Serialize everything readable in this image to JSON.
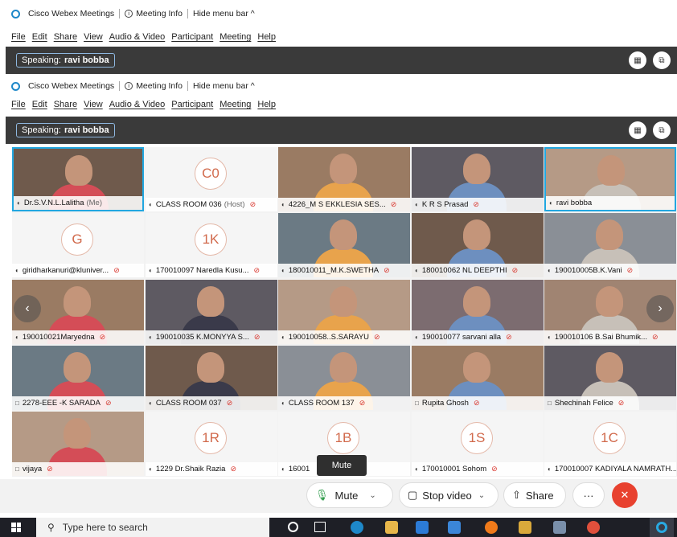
{
  "app": {
    "name": "Cisco Webex Meetings",
    "meeting_info": "Meeting Info",
    "hide_menu_bar": "Hide menu bar ^"
  },
  "menu": [
    "File",
    "Edit",
    "Share",
    "View",
    "Audio & Video",
    "Participant",
    "Meeting",
    "Help"
  ],
  "speaking": {
    "label": "Speaking:",
    "name": "ravi bobba"
  },
  "tiles": [
    {
      "name": "Dr.S.V.N.L.Lalitha",
      "suffix": "(Me)",
      "kind": "video",
      "muted": false
    },
    {
      "name": "CLASS ROOM 036",
      "suffix": "(Host)",
      "kind": "avatar",
      "initials": "C0",
      "muted": true
    },
    {
      "name": "4226_M S EKKLESIA SES...",
      "kind": "video",
      "muted": true
    },
    {
      "name": "K R S Prasad",
      "kind": "video",
      "muted": true
    },
    {
      "name": "ravi bobba",
      "kind": "video",
      "muted": false
    },
    {
      "name": "giridharkanuri@kluniver...",
      "kind": "avatar",
      "initials": "G",
      "muted": true
    },
    {
      "name": "170010097 Naredla Kusu...",
      "kind": "avatar",
      "initials": "1K",
      "muted": true
    },
    {
      "name": "180010011_M.K.SWETHA",
      "kind": "video",
      "muted": true
    },
    {
      "name": "180010062 NL DEEPTHI",
      "kind": "video",
      "muted": true
    },
    {
      "name": "190010005B.K.Vani",
      "kind": "video",
      "muted": true
    },
    {
      "name": "190010021Maryedna",
      "kind": "video",
      "muted": true
    },
    {
      "name": "190010035 K.MONYYA S...",
      "kind": "video",
      "muted": true
    },
    {
      "name": "190010058..S.SARAYU",
      "kind": "video",
      "muted": true
    },
    {
      "name": "190010077 sarvani alla",
      "kind": "video",
      "muted": true
    },
    {
      "name": "190010106 B.Sai Bhumik...",
      "kind": "video",
      "muted": true
    },
    {
      "name": "2278-EEE -K SARADA",
      "kind": "video",
      "muted": true
    },
    {
      "name": "CLASS ROOM 037",
      "kind": "video",
      "muted": true
    },
    {
      "name": "CLASS ROOM 137",
      "kind": "video",
      "muted": true
    },
    {
      "name": "Rupita Ghosh",
      "kind": "video",
      "muted": true
    },
    {
      "name": "Shechinah Felice",
      "kind": "video",
      "muted": true
    },
    {
      "name": "vijaya",
      "kind": "video",
      "muted": true
    },
    {
      "name": "1229 Dr.Shaik Razia",
      "kind": "avatar",
      "initials": "1R",
      "muted": true
    },
    {
      "name": "16001",
      "kind": "avatar",
      "initials": "1B",
      "muted": false
    },
    {
      "name": "170010001 Sohom",
      "kind": "avatar",
      "initials": "1S",
      "muted": true
    },
    {
      "name": "170010007 KADIYALA NAMRATH...",
      "kind": "avatar",
      "initials": "1C",
      "muted": false
    }
  ],
  "tooltip": "Mute",
  "controls": {
    "mute": "Mute",
    "stop_video": "Stop video",
    "share": "Share",
    "more": "···",
    "leave": "✕"
  },
  "taskbar": {
    "search_placeholder": "Type here to search"
  },
  "colors": {
    "accent": "#22a7e0",
    "leave": "#e8412f",
    "dark_bar": "#3a3a3a",
    "muted_icon": "#d9342b"
  }
}
